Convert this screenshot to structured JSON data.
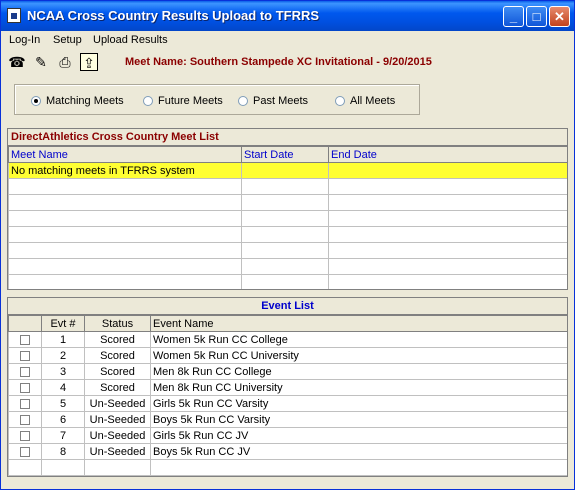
{
  "window": {
    "title": "NCAA Cross Country Results Upload to TFRRS"
  },
  "menu": {
    "items": [
      "Log-In",
      "Setup",
      "Upload Results"
    ]
  },
  "meet": {
    "label": "Meet Name:",
    "value": "Southern Stampede XC Invitational - 9/20/2015"
  },
  "filters": {
    "options": [
      "Matching Meets",
      "Future Meets",
      "Past Meets",
      "All Meets"
    ],
    "selected": "Matching Meets"
  },
  "meet_list": {
    "title": "DirectAthletics Cross Country Meet List",
    "columns": [
      "Meet Name",
      "Start Date",
      "End Date"
    ],
    "rows": [
      [
        "No matching meets in TFRRS system",
        "",
        ""
      ]
    ]
  },
  "event_list": {
    "title": "Event List",
    "columns": [
      "",
      "Evt #",
      "Status",
      "Event Name"
    ],
    "rows": [
      [
        "1",
        "Scored",
        "Women 5k Run CC College"
      ],
      [
        "2",
        "Scored",
        "Women 5k Run CC University"
      ],
      [
        "3",
        "Scored",
        "Men 8k Run CC College"
      ],
      [
        "4",
        "Scored",
        "Men 8k Run CC University"
      ],
      [
        "5",
        "Un-Seeded",
        "Girls 5k Run CC Varsity"
      ],
      [
        "6",
        "Un-Seeded",
        "Boys 5k Run CC Varsity"
      ],
      [
        "7",
        "Un-Seeded",
        "Girls 5k Run CC JV"
      ],
      [
        "8",
        "Un-Seeded",
        "Boys 5k Run CC JV"
      ]
    ]
  },
  "colors": {
    "title_bar": "#0054e3",
    "meet_name": "#8b0000",
    "header_text": "#0000cc",
    "highlight_row": "#ffff33"
  },
  "icons": [
    "phone-icon",
    "notepad-icon",
    "network-icon",
    "upload-icon"
  ]
}
